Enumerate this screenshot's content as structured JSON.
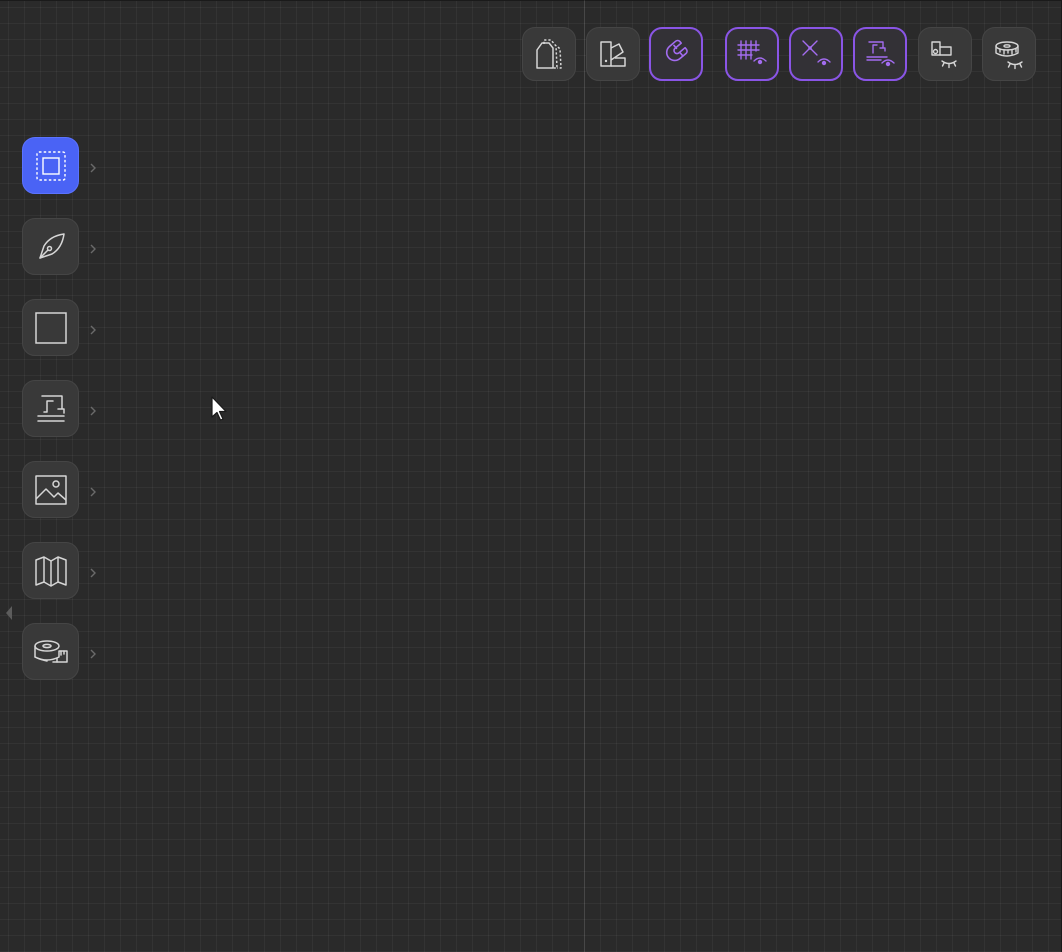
{
  "top_toolbar": {
    "buttons": [
      {
        "icon": "seam-allowance-icon",
        "state": "default"
      },
      {
        "icon": "fabric-swatch-icon",
        "state": "default"
      },
      {
        "icon": "magnet-snap-icon",
        "state": "enabled"
      },
      {
        "icon": "grid-visibility-icon",
        "state": "enabled"
      },
      {
        "icon": "points-visibility-icon",
        "state": "enabled"
      },
      {
        "icon": "stitch-visibility-icon",
        "state": "enabled"
      },
      {
        "icon": "pieces-visibility-hidden-icon",
        "state": "default"
      },
      {
        "icon": "measure-visibility-hidden-icon",
        "state": "default"
      }
    ]
  },
  "left_toolbar": {
    "tools": [
      {
        "icon": "select-marquee-icon",
        "state": "active"
      },
      {
        "icon": "pen-nib-icon",
        "state": "default"
      },
      {
        "icon": "rectangle-icon",
        "state": "default"
      },
      {
        "icon": "sewing-machine-icon",
        "state": "default"
      },
      {
        "icon": "image-icon",
        "state": "default"
      },
      {
        "icon": "map-icon",
        "state": "default"
      },
      {
        "icon": "measuring-tape-icon",
        "state": "default"
      }
    ]
  },
  "colors": {
    "canvas": "#2a2a2a",
    "active_tool": "#4a63f5",
    "toggle_on_border": "#8a55e6",
    "toggle_on_icon": "#a36cf0",
    "icon_default": "#d6d6d6"
  }
}
